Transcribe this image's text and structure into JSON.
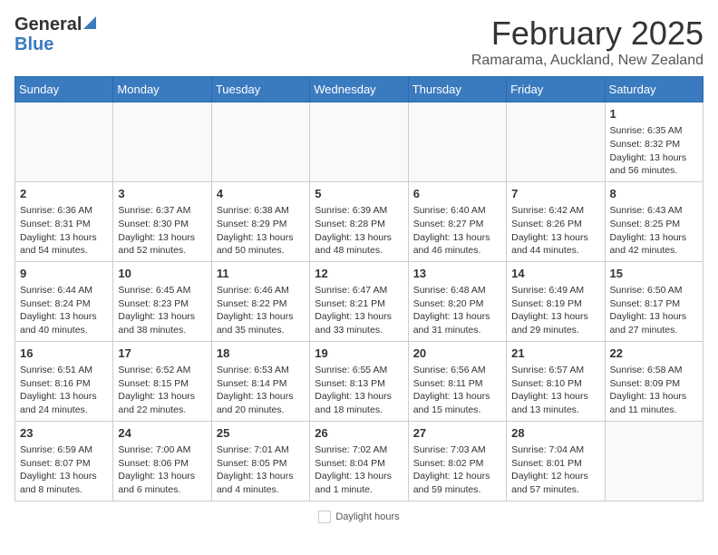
{
  "header": {
    "logo_general": "General",
    "logo_blue": "Blue",
    "month": "February 2025",
    "location": "Ramarama, Auckland, New Zealand"
  },
  "days_of_week": [
    "Sunday",
    "Monday",
    "Tuesday",
    "Wednesday",
    "Thursday",
    "Friday",
    "Saturday"
  ],
  "weeks": [
    [
      {
        "day": "",
        "info": ""
      },
      {
        "day": "",
        "info": ""
      },
      {
        "day": "",
        "info": ""
      },
      {
        "day": "",
        "info": ""
      },
      {
        "day": "",
        "info": ""
      },
      {
        "day": "",
        "info": ""
      },
      {
        "day": "1",
        "info": "Sunrise: 6:35 AM\nSunset: 8:32 PM\nDaylight: 13 hours and 56 minutes."
      }
    ],
    [
      {
        "day": "2",
        "info": "Sunrise: 6:36 AM\nSunset: 8:31 PM\nDaylight: 13 hours and 54 minutes."
      },
      {
        "day": "3",
        "info": "Sunrise: 6:37 AM\nSunset: 8:30 PM\nDaylight: 13 hours and 52 minutes."
      },
      {
        "day": "4",
        "info": "Sunrise: 6:38 AM\nSunset: 8:29 PM\nDaylight: 13 hours and 50 minutes."
      },
      {
        "day": "5",
        "info": "Sunrise: 6:39 AM\nSunset: 8:28 PM\nDaylight: 13 hours and 48 minutes."
      },
      {
        "day": "6",
        "info": "Sunrise: 6:40 AM\nSunset: 8:27 PM\nDaylight: 13 hours and 46 minutes."
      },
      {
        "day": "7",
        "info": "Sunrise: 6:42 AM\nSunset: 8:26 PM\nDaylight: 13 hours and 44 minutes."
      },
      {
        "day": "8",
        "info": "Sunrise: 6:43 AM\nSunset: 8:25 PM\nDaylight: 13 hours and 42 minutes."
      }
    ],
    [
      {
        "day": "9",
        "info": "Sunrise: 6:44 AM\nSunset: 8:24 PM\nDaylight: 13 hours and 40 minutes."
      },
      {
        "day": "10",
        "info": "Sunrise: 6:45 AM\nSunset: 8:23 PM\nDaylight: 13 hours and 38 minutes."
      },
      {
        "day": "11",
        "info": "Sunrise: 6:46 AM\nSunset: 8:22 PM\nDaylight: 13 hours and 35 minutes."
      },
      {
        "day": "12",
        "info": "Sunrise: 6:47 AM\nSunset: 8:21 PM\nDaylight: 13 hours and 33 minutes."
      },
      {
        "day": "13",
        "info": "Sunrise: 6:48 AM\nSunset: 8:20 PM\nDaylight: 13 hours and 31 minutes."
      },
      {
        "day": "14",
        "info": "Sunrise: 6:49 AM\nSunset: 8:19 PM\nDaylight: 13 hours and 29 minutes."
      },
      {
        "day": "15",
        "info": "Sunrise: 6:50 AM\nSunset: 8:17 PM\nDaylight: 13 hours and 27 minutes."
      }
    ],
    [
      {
        "day": "16",
        "info": "Sunrise: 6:51 AM\nSunset: 8:16 PM\nDaylight: 13 hours and 24 minutes."
      },
      {
        "day": "17",
        "info": "Sunrise: 6:52 AM\nSunset: 8:15 PM\nDaylight: 13 hours and 22 minutes."
      },
      {
        "day": "18",
        "info": "Sunrise: 6:53 AM\nSunset: 8:14 PM\nDaylight: 13 hours and 20 minutes."
      },
      {
        "day": "19",
        "info": "Sunrise: 6:55 AM\nSunset: 8:13 PM\nDaylight: 13 hours and 18 minutes."
      },
      {
        "day": "20",
        "info": "Sunrise: 6:56 AM\nSunset: 8:11 PM\nDaylight: 13 hours and 15 minutes."
      },
      {
        "day": "21",
        "info": "Sunrise: 6:57 AM\nSunset: 8:10 PM\nDaylight: 13 hours and 13 minutes."
      },
      {
        "day": "22",
        "info": "Sunrise: 6:58 AM\nSunset: 8:09 PM\nDaylight: 13 hours and 11 minutes."
      }
    ],
    [
      {
        "day": "23",
        "info": "Sunrise: 6:59 AM\nSunset: 8:07 PM\nDaylight: 13 hours and 8 minutes."
      },
      {
        "day": "24",
        "info": "Sunrise: 7:00 AM\nSunset: 8:06 PM\nDaylight: 13 hours and 6 minutes."
      },
      {
        "day": "25",
        "info": "Sunrise: 7:01 AM\nSunset: 8:05 PM\nDaylight: 13 hours and 4 minutes."
      },
      {
        "day": "26",
        "info": "Sunrise: 7:02 AM\nSunset: 8:04 PM\nDaylight: 13 hours and 1 minute."
      },
      {
        "day": "27",
        "info": "Sunrise: 7:03 AM\nSunset: 8:02 PM\nDaylight: 12 hours and 59 minutes."
      },
      {
        "day": "28",
        "info": "Sunrise: 7:04 AM\nSunset: 8:01 PM\nDaylight: 12 hours and 57 minutes."
      },
      {
        "day": "",
        "info": ""
      }
    ]
  ],
  "footer": {
    "daylight_label": "Daylight hours"
  }
}
